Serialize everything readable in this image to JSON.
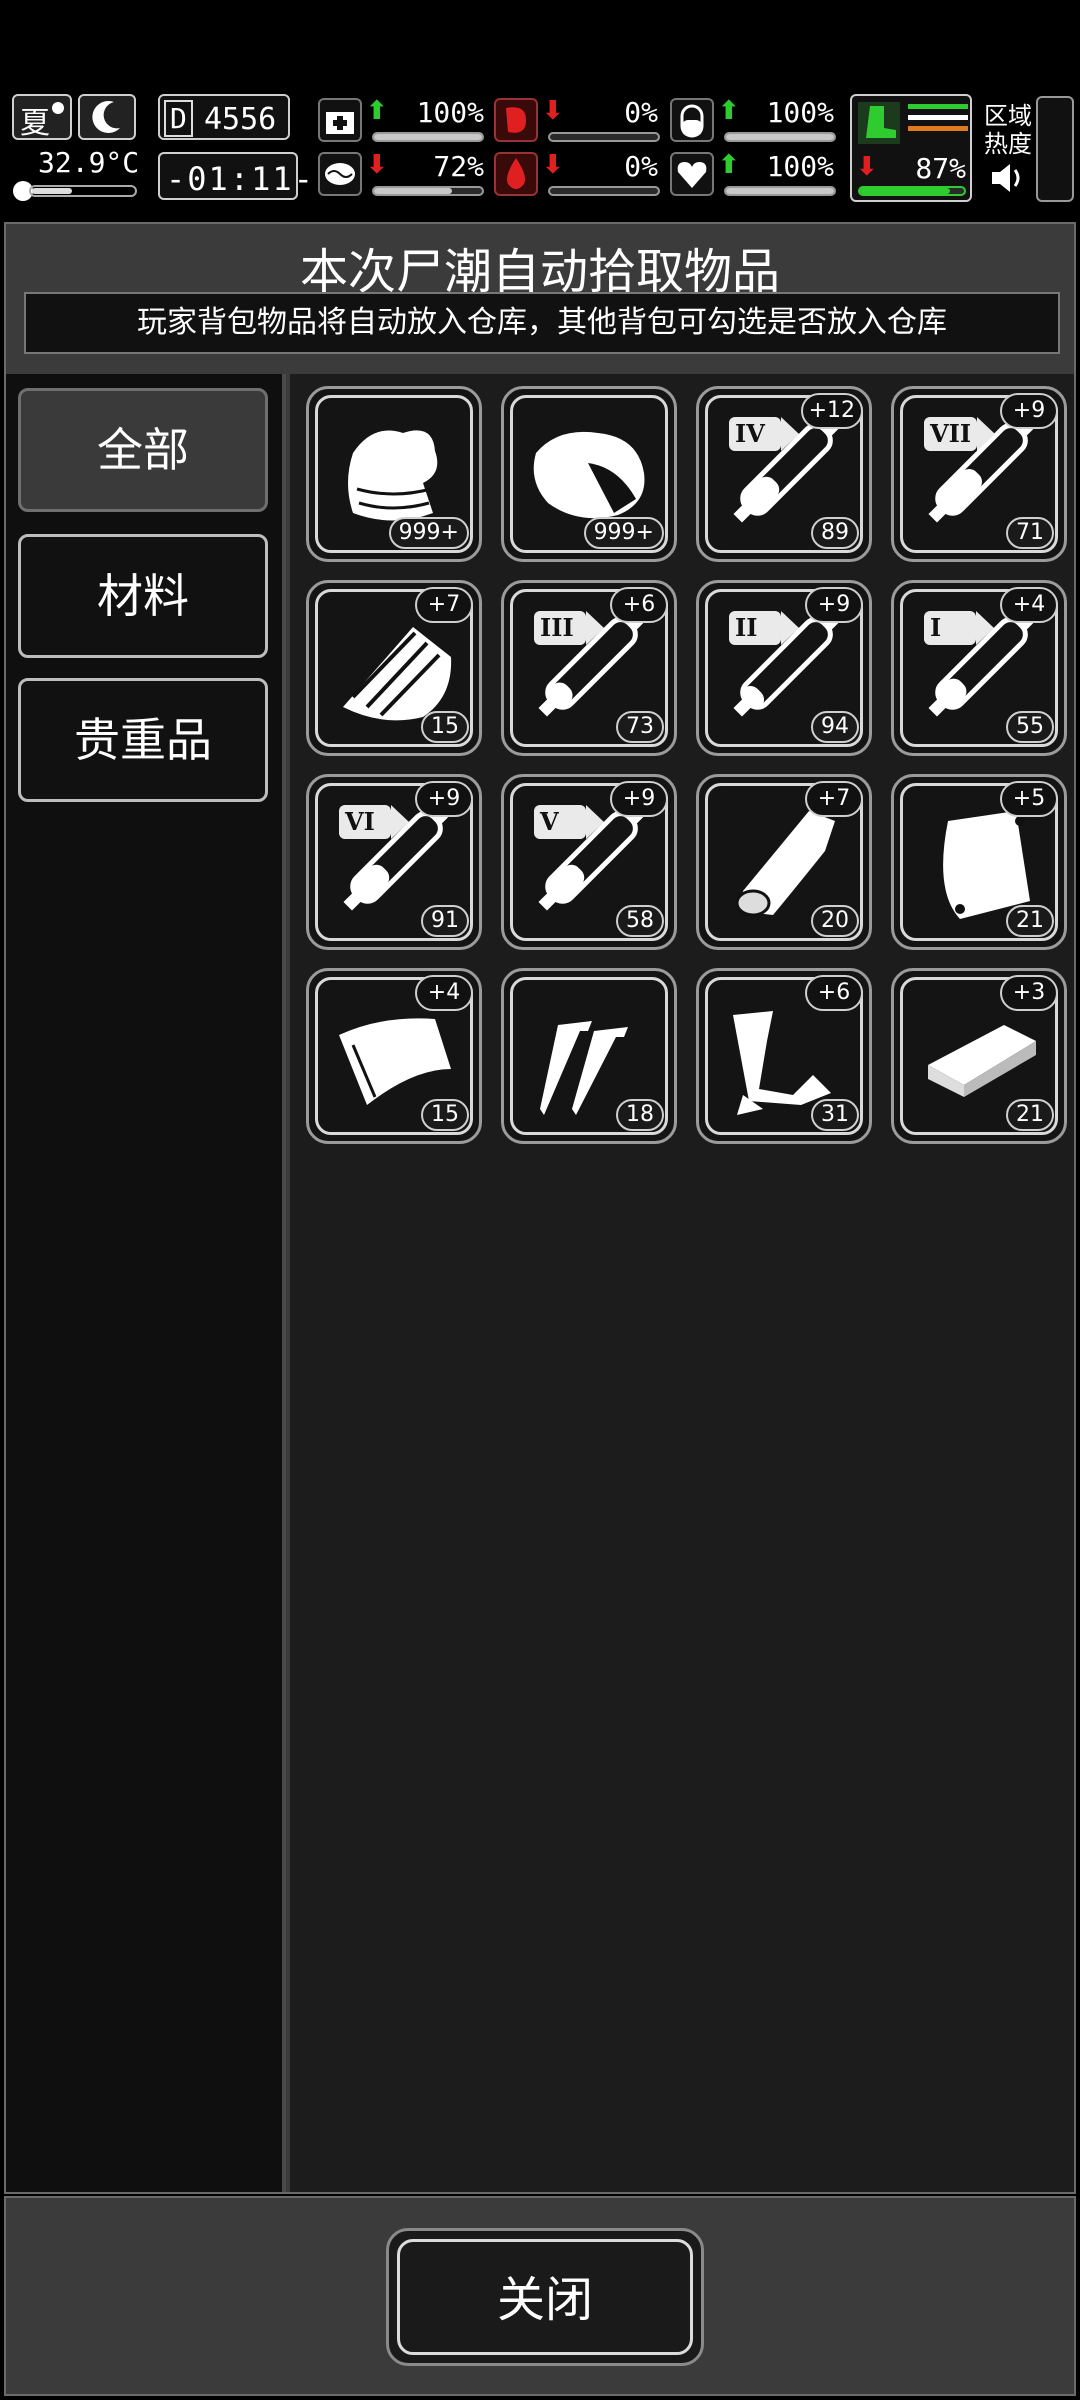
{
  "hud": {
    "season": "夏",
    "temperature": "32.9°C",
    "counter": "4556",
    "counter_prefix": "D",
    "clock": "-01:11-",
    "stats": [
      {
        "name": "health",
        "icon": "medkit-icon",
        "arrow": "up",
        "value": "100%",
        "level": 1.0
      },
      {
        "name": "hunger",
        "icon": "stomach-icon",
        "arrow": "down",
        "value": "0%",
        "level": 0.0
      },
      {
        "name": "medicine",
        "icon": "pill-icon",
        "arrow": "up",
        "value": "100%",
        "level": 1.0
      },
      {
        "name": "mental",
        "icon": "brain-icon",
        "arrow": "down",
        "value": "72%",
        "level": 0.72
      },
      {
        "name": "thirst",
        "icon": "blood-drop-icon",
        "arrow": "down",
        "value": "0%",
        "level": 0.0
      },
      {
        "name": "heart",
        "icon": "heart-icon",
        "arrow": "up",
        "value": "100%",
        "level": 1.0
      }
    ],
    "stamina": {
      "value": "87%",
      "level": 0.87
    },
    "zone_heat_label": "区域\n热度",
    "colors": {
      "up": "#2ecc2e",
      "down": "#e02020",
      "boot": "#2ecc2e",
      "stripe_orange": "#e07a20"
    }
  },
  "panel": {
    "title": "本次尸潮自动拾取物品",
    "subtitle": "玩家背包物品将自动放入仓库，其他背包可勾选是否放入仓库"
  },
  "categories": [
    {
      "label": "全部",
      "active": true
    },
    {
      "label": "材料",
      "active": false
    },
    {
      "label": "贵重品",
      "active": false
    }
  ],
  "items": [
    {
      "icon": "cloth-pile-icon",
      "count": "999+",
      "plus": "",
      "tier": ""
    },
    {
      "icon": "meat-chunk-icon",
      "count": "999+",
      "plus": "",
      "tier": ""
    },
    {
      "icon": "syringe-icon",
      "count": "89",
      "plus": "+12",
      "tier": "IV",
      "fill": 0.35
    },
    {
      "icon": "syringe-icon",
      "count": "71",
      "plus": "+9",
      "tier": "VII",
      "fill": 0.45
    },
    {
      "icon": "wood-plank-icon",
      "count": "15",
      "plus": "+7",
      "tier": ""
    },
    {
      "icon": "syringe-icon",
      "count": "73",
      "plus": "+6",
      "tier": "III",
      "fill": 0.2
    },
    {
      "icon": "syringe-icon",
      "count": "94",
      "plus": "+9",
      "tier": "II",
      "fill": 0.15
    },
    {
      "icon": "syringe-icon",
      "count": "55",
      "plus": "+4",
      "tier": "I",
      "fill": 0.25
    },
    {
      "icon": "syringe-icon",
      "count": "91",
      "plus": "+9",
      "tier": "VI",
      "fill": 0.35
    },
    {
      "icon": "syringe-icon",
      "count": "58",
      "plus": "+9",
      "tier": "V",
      "fill": 0.35
    },
    {
      "icon": "log-icon",
      "count": "20",
      "plus": "+7",
      "tier": ""
    },
    {
      "icon": "pouch-icon",
      "count": "21",
      "plus": "+5",
      "tier": ""
    },
    {
      "icon": "fabric-sheet-icon",
      "count": "15",
      "plus": "+4",
      "tier": ""
    },
    {
      "icon": "nails-icon",
      "count": "18",
      "plus": "",
      "tier": ""
    },
    {
      "icon": "scrap-pieces-icon",
      "count": "31",
      "plus": "+6",
      "tier": ""
    },
    {
      "icon": "box-icon",
      "count": "21",
      "plus": "+3",
      "tier": ""
    }
  ],
  "footer": {
    "close_label": "关闭"
  }
}
